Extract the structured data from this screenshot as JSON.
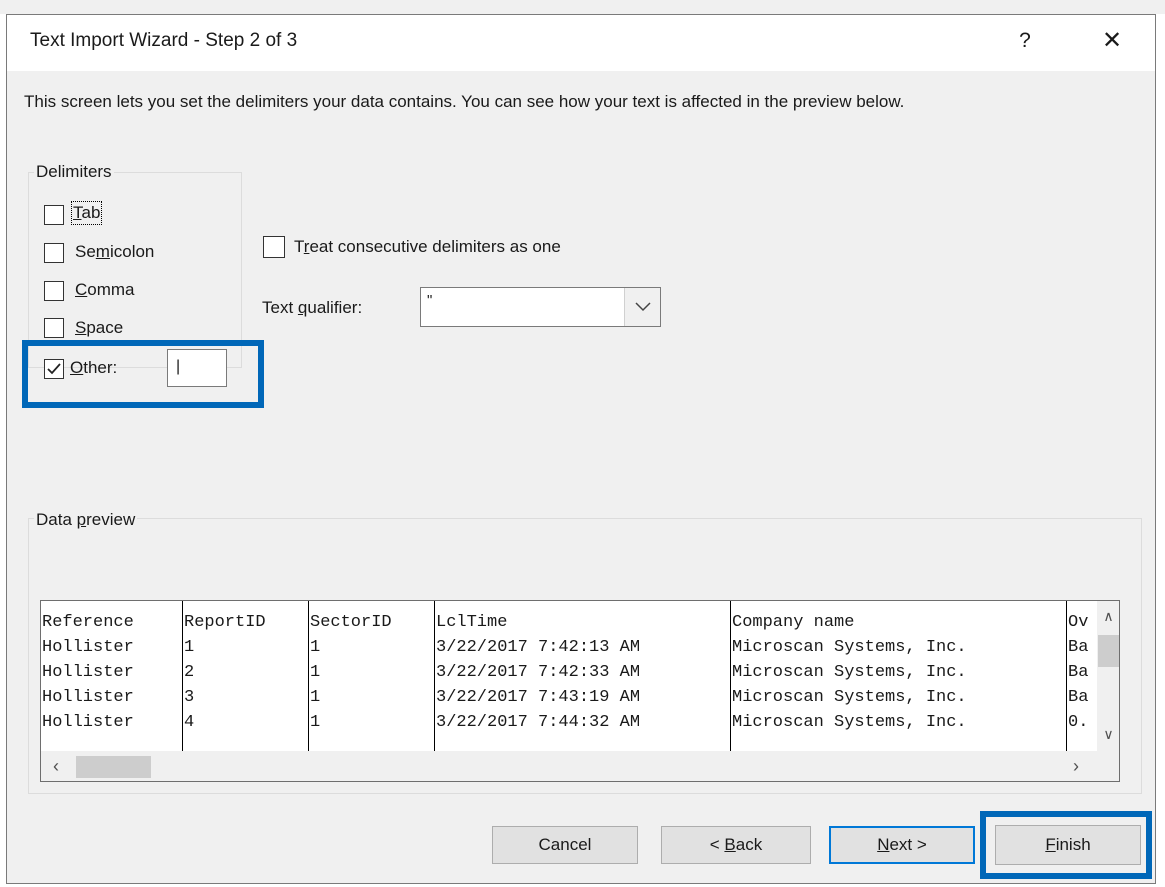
{
  "window": {
    "title": "Text Import Wizard - Step 2 of 3",
    "help_label": "?",
    "close_label": "✕"
  },
  "description": "This screen lets you set the delimiters your data contains.  You can see how your text is affected in the preview below.",
  "delimiters": {
    "group_label": "Delimiters",
    "tab": {
      "label_pre": "",
      "label_u": "T",
      "label_post": "ab",
      "checked": false
    },
    "semicolon": {
      "label_pre": "Se",
      "label_u": "m",
      "label_post": "icolon",
      "checked": false
    },
    "comma": {
      "label_pre": "",
      "label_u": "C",
      "label_post": "omma",
      "checked": false
    },
    "space": {
      "label_pre": "",
      "label_u": "S",
      "label_post": "pace",
      "checked": false
    },
    "other": {
      "label_pre": "",
      "label_u": "O",
      "label_post": "ther:",
      "checked": true,
      "value": "|"
    }
  },
  "options": {
    "consecutive": {
      "label_pre": "T",
      "label_u": "r",
      "label_post": "eat consecutive delimiters as one",
      "checked": false
    },
    "qualifier": {
      "label_pre": "Text ",
      "label_u": "q",
      "label_post": "ualifier:",
      "value": "\""
    }
  },
  "preview": {
    "group_label_pre": "Data ",
    "group_label_u": "p",
    "group_label_post": "review",
    "columns": [
      "Reference",
      "ReportID",
      "SectorID",
      "LclTime",
      "Company name",
      "Ov"
    ],
    "rows": [
      [
        "Hollister",
        "1",
        "1",
        "3/22/2017 7:42:13 AM",
        "Microscan Systems, Inc.",
        "Ba"
      ],
      [
        "Hollister",
        "2",
        "1",
        "3/22/2017 7:42:33 AM",
        "Microscan Systems, Inc.",
        "Ba"
      ],
      [
        "Hollister",
        "3",
        "1",
        "3/22/2017 7:43:19 AM",
        "Microscan Systems, Inc.",
        "Ba"
      ],
      [
        "Hollister",
        "4",
        "1",
        "3/22/2017 7:44:32 AM",
        "Microscan Systems, Inc.",
        "0."
      ]
    ]
  },
  "buttons": {
    "cancel": "Cancel",
    "back_pre": "< ",
    "back_u": "B",
    "back_post": "ack",
    "next_pre": "",
    "next_u": "N",
    "next_post": "ext >",
    "finish_pre": "",
    "finish_u": "F",
    "finish_post": "inish"
  },
  "colors": {
    "highlight": "#0067b8",
    "default_button_border": "#0078d7",
    "dialog_bg": "#f0f0f0"
  }
}
